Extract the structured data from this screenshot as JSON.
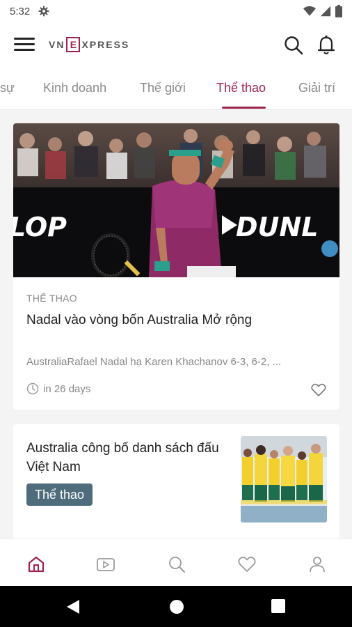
{
  "status_bar": {
    "time": "5:32"
  },
  "app_bar": {
    "logo_left": "VN",
    "logo_mid": "E",
    "logo_right": "XPRESS"
  },
  "tabs": [
    {
      "label": "sự"
    },
    {
      "label": "Kinh doanh"
    },
    {
      "label": "Thế giới"
    },
    {
      "label": "Thể thao",
      "active": true
    },
    {
      "label": "Giải trí"
    }
  ],
  "articles": [
    {
      "category": "THỂ THAO",
      "title": "Nadal vào vòng bốn Australia Mở rộng",
      "summary": "AustraliaRafael Nadal hạ Karen Khachanov 6-3, 6-2, ...",
      "time": "in 26 days",
      "banner_left": "LOP",
      "banner_right": "DUNL"
    },
    {
      "title": "Australia công bố danh sách đấu Việt Nam",
      "badge": "Thể thao"
    }
  ],
  "colors": {
    "accent": "#9f224e",
    "badge": "#4e6c7c",
    "background": "#f4f4f4"
  }
}
